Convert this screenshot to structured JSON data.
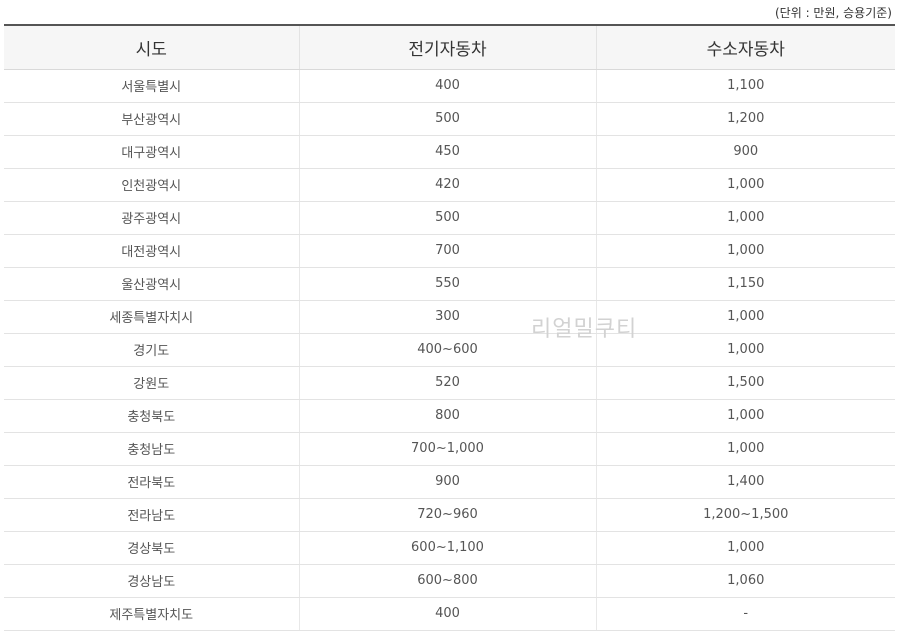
{
  "unit_note": "(단위 : 만원, 승용기준)",
  "watermark": "리얼밀쿠티",
  "table": {
    "headers": [
      "시도",
      "전기자동차",
      "수소자동차"
    ],
    "rows": [
      [
        "서울특별시",
        "400",
        "1,100"
      ],
      [
        "부산광역시",
        "500",
        "1,200"
      ],
      [
        "대구광역시",
        "450",
        "900"
      ],
      [
        "인천광역시",
        "420",
        "1,000"
      ],
      [
        "광주광역시",
        "500",
        "1,000"
      ],
      [
        "대전광역시",
        "700",
        "1,000"
      ],
      [
        "울산광역시",
        "550",
        "1,150"
      ],
      [
        "세종특별자치시",
        "300",
        "1,000"
      ],
      [
        "경기도",
        "400~600",
        "1,000"
      ],
      [
        "강원도",
        "520",
        "1,500"
      ],
      [
        "충청북도",
        "800",
        "1,000"
      ],
      [
        "충청남도",
        "700~1,000",
        "1,000"
      ],
      [
        "전라북도",
        "900",
        "1,400"
      ],
      [
        "전라남도",
        "720~960",
        "1,200~1,500"
      ],
      [
        "경상북도",
        "600~1,100",
        "1,000"
      ],
      [
        "경상남도",
        "600~800",
        "1,060"
      ],
      [
        "제주특별자치도",
        "400",
        "-"
      ]
    ]
  }
}
